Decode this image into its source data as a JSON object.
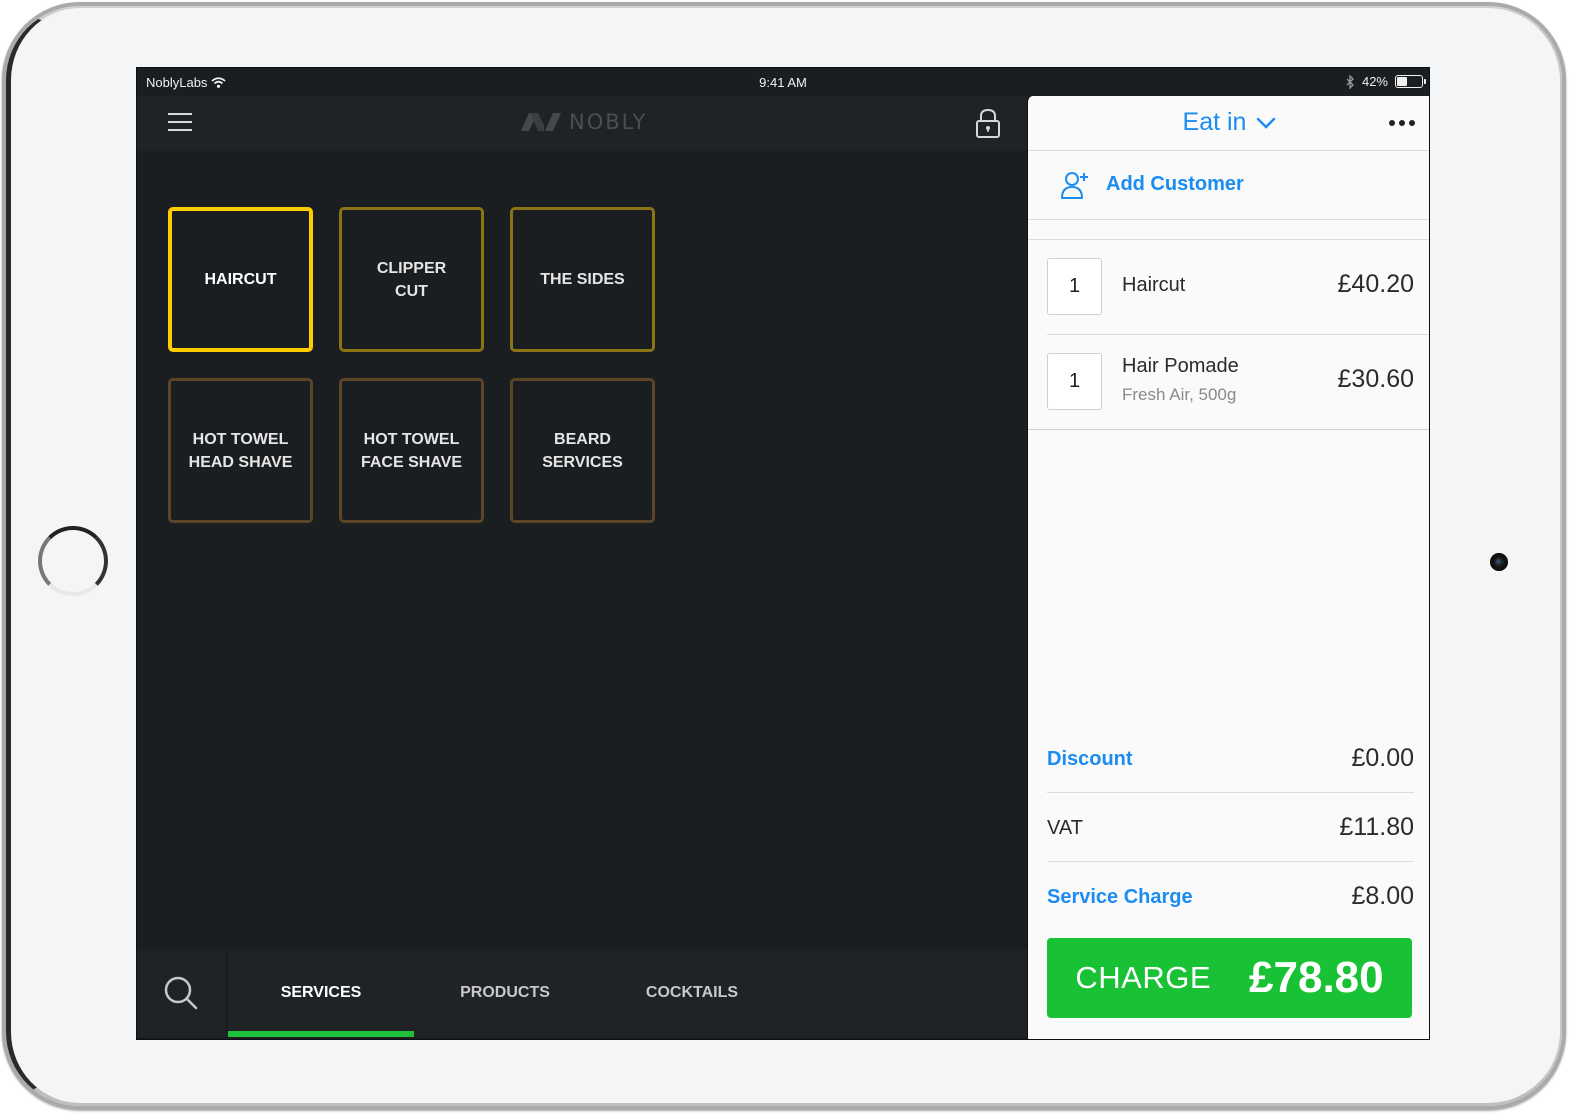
{
  "status_bar": {
    "carrier": "NoblyLabs",
    "time": "9:41 AM",
    "battery_percent_label": "42%",
    "battery_level": 0.42
  },
  "header": {
    "logo_text": "NOBLY"
  },
  "tiles": [
    {
      "label": "HAIRCUT",
      "state": "selected"
    },
    {
      "label": "CLIPPER\nCUT",
      "state": "normal"
    },
    {
      "label": "THE SIDES",
      "state": "normal"
    },
    {
      "label": "HOT TOWEL\nHEAD SHAVE",
      "state": "normal"
    },
    {
      "label": "HOT TOWEL\nFACE SHAVE",
      "state": "normal"
    },
    {
      "label": "BEARD\nSERVICES",
      "state": "normal"
    }
  ],
  "tabs": [
    {
      "label": "SERVICES",
      "active": true
    },
    {
      "label": "PRODUCTS",
      "active": false
    },
    {
      "label": "COCKTAILS",
      "active": false
    }
  ],
  "cart": {
    "order_type": "Eat in",
    "add_customer_label": "Add Customer",
    "items": [
      {
        "qty": "1",
        "name": "Haircut",
        "variant": "",
        "price": "£40.20"
      },
      {
        "qty": "1",
        "name": "Hair Pomade",
        "variant": "Fresh Air, 500g",
        "price": "£30.60"
      }
    ],
    "totals": [
      {
        "label": "Discount",
        "value": "£0.00",
        "link": true
      },
      {
        "label": "VAT",
        "value": "£11.80",
        "link": false
      },
      {
        "label": "Service Charge",
        "value": "£8.00",
        "link": true
      }
    ],
    "charge_label": "CHARGE",
    "charge_amount": "£78.80"
  },
  "colors": {
    "accent_blue": "#1b8cf2",
    "charge_green": "#18c234",
    "selected_tile": "#ffcc00",
    "tile_border_gold": "#8a7312",
    "tile_border_brown": "#5c4428"
  }
}
